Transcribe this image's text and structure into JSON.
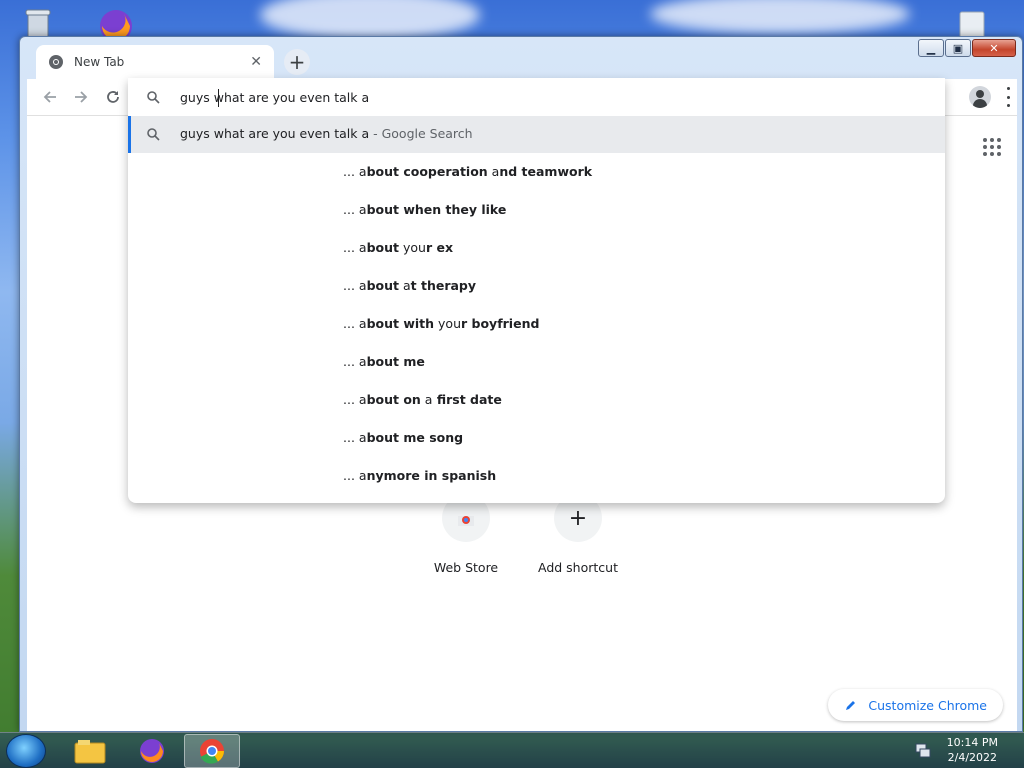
{
  "browser": {
    "tab_title": "New Tab",
    "tab_close": "✕",
    "new_tab": "+"
  },
  "omnibox": {
    "input_value": "guys what are you even talk a",
    "first_suggestion": "guys what are you even talk a",
    "first_suggestion_suffix": " - Google Search",
    "suggestions": [
      {
        "prefix": "... ",
        "parts": [
          [
            "a",
            false
          ],
          [
            "bout cooperation",
            true
          ],
          [
            " a",
            false
          ],
          [
            "nd teamwork",
            true
          ]
        ]
      },
      {
        "prefix": "... ",
        "parts": [
          [
            "a",
            false
          ],
          [
            "bout when they like",
            true
          ]
        ]
      },
      {
        "prefix": "... ",
        "parts": [
          [
            "a",
            false
          ],
          [
            "bout",
            true
          ],
          [
            " you",
            false
          ],
          [
            "r ex",
            true
          ]
        ]
      },
      {
        "prefix": "... ",
        "parts": [
          [
            "a",
            false
          ],
          [
            "bout",
            true
          ],
          [
            " a",
            false
          ],
          [
            "t therapy",
            true
          ]
        ]
      },
      {
        "prefix": "... ",
        "parts": [
          [
            "a",
            false
          ],
          [
            "bout with",
            true
          ],
          [
            " you",
            false
          ],
          [
            "r boyfriend",
            true
          ]
        ]
      },
      {
        "prefix": "... ",
        "parts": [
          [
            "a",
            false
          ],
          [
            "bout me",
            true
          ]
        ]
      },
      {
        "prefix": "... ",
        "parts": [
          [
            "a",
            false
          ],
          [
            "bout on",
            true
          ],
          [
            " a",
            false
          ],
          [
            " first date",
            true
          ]
        ]
      },
      {
        "prefix": "... ",
        "parts": [
          [
            "a",
            false
          ],
          [
            "bout me song",
            true
          ]
        ]
      },
      {
        "prefix": "... ",
        "parts": [
          [
            "a",
            false
          ],
          [
            "nymore in spanish",
            true
          ]
        ]
      }
    ]
  },
  "shortcuts": [
    {
      "label": "Web Store"
    },
    {
      "label": "Add shortcut"
    }
  ],
  "customize_label": "Customize Chrome",
  "taskbar": {
    "time": "10:14 PM",
    "date": "2/4/2022"
  },
  "colors": {
    "accent": "#1a73e8",
    "suggestion_highlight": "#e8eaed"
  }
}
